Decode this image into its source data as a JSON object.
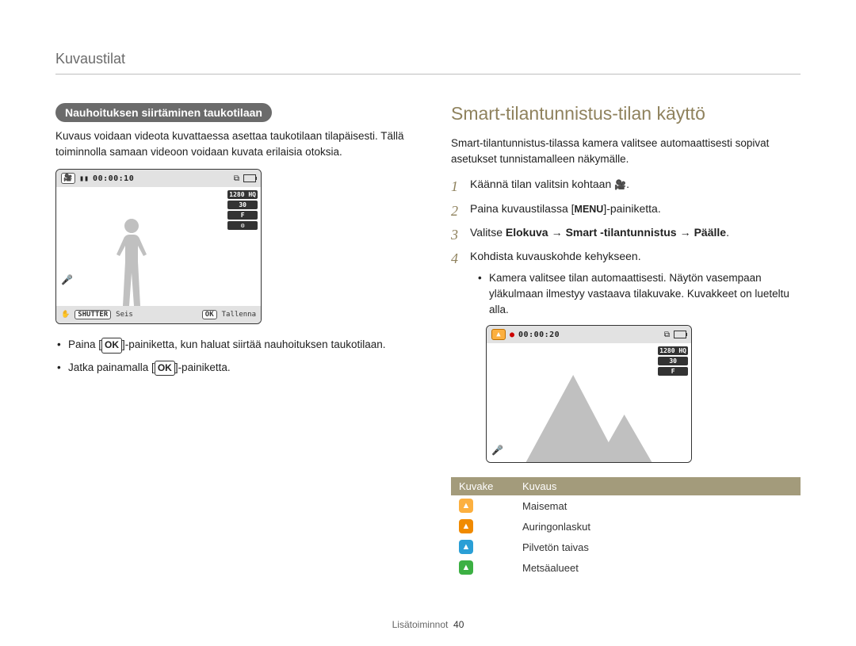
{
  "section_header": "Kuvaustilat",
  "left": {
    "pill": "Nauhoituksen siirtäminen taukotilaan",
    "intro": "Kuvaus voidaan videota kuvattaessa asettaa taukotilaan tilapäisesti. Tällä toiminnolla samaan videoon voidaan kuvata erilaisia otoksia.",
    "cam": {
      "time": "00:00:10",
      "right_badges": [
        "1280 HQ",
        "30",
        "F",
        "⚙"
      ],
      "shutter_label": "SHUTTER",
      "seis": "Seis",
      "ok_label": "OK",
      "tallenna": "Tallenna"
    },
    "bullets": [
      {
        "pre": "Paina [",
        "ok": "OK",
        "post": "]-painiketta, kun haluat siirtää nauhoituksen taukotilaan."
      },
      {
        "pre": "Jatka painamalla [",
        "ok": "OK",
        "post": "]-painiketta."
      }
    ]
  },
  "right": {
    "title": "Smart-tilantunnistus-tilan käyttö",
    "intro": "Smart-tilantunnistus-tilassa kamera valitsee automaattisesti sopivat asetukset tunnistamalleen näkymälle.",
    "steps": [
      {
        "pre": "Käännä tilan valitsin kohtaan ",
        "iconName": "movie-mode-icon",
        "iconGlyph": "🎥",
        "post": "."
      },
      {
        "pre": "Paina kuvaustilassa [",
        "key": "MENU",
        "post": "]-painiketta."
      },
      {
        "pre": "Valitse ",
        "bold1": "Elokuva",
        "arrow1": "→",
        "bold2": "Smart ‑tilantunnistus",
        "arrow2": "→",
        "bold3": "Päälle",
        "post": "."
      },
      {
        "pre": "Kohdista kuvauskohde kehykseen.",
        "sub": "Kamera valitsee tilan automaattisesti. Näytön vasempaan yläkulmaan ilmestyy vastaava tilakuvake. Kuvakkeet on lueteltu alla."
      }
    ],
    "cam": {
      "time": "00:00:20",
      "right_badges": [
        "1280 HQ",
        "30",
        "F"
      ]
    },
    "table": {
      "head": [
        "Kuvake",
        "Kuvaus"
      ],
      "rows": [
        {
          "color": "ic-orange",
          "glyph": "▲",
          "label": "Maisemat"
        },
        {
          "color": "ic-orange2",
          "glyph": "▲",
          "label": "Auringonlaskut"
        },
        {
          "color": "ic-blue",
          "glyph": "▲",
          "label": "Pilvetön taivas"
        },
        {
          "color": "ic-green",
          "glyph": "▲",
          "label": "Metsäalueet"
        }
      ]
    }
  },
  "footer": {
    "section": "Lisätoiminnot",
    "page": "40"
  }
}
